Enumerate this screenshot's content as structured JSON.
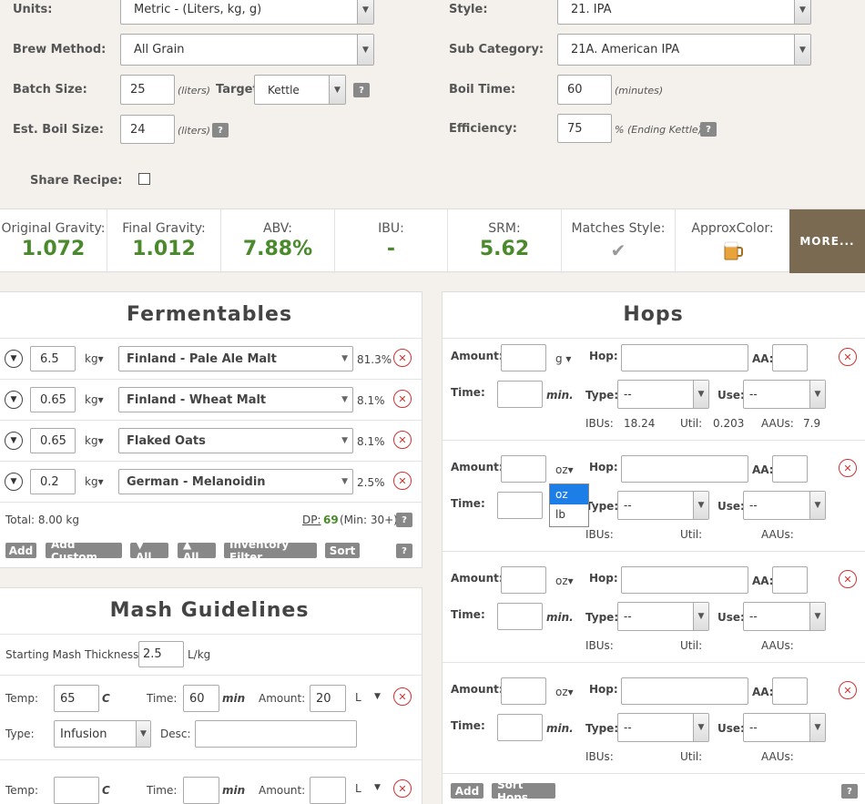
{
  "form": {
    "units_label": "Units:",
    "units_value": "Metric - (Liters, kg, g)",
    "brew_method_label": "Brew Method:",
    "brew_method_value": "All Grain",
    "batch_size_label": "Batch Size:",
    "batch_size_value": "25",
    "batch_unit": "(liters)",
    "target_label": "Target:",
    "target_value": "Kettle",
    "boil_size_label": "Est. Boil Size:",
    "boil_size_value": "24",
    "boil_size_unit": "(liters)",
    "share_label": "Share Recipe:",
    "style_label": "Style:",
    "style_value": "21. IPA",
    "subcat_label": "Sub Category:",
    "subcat_value": "21A. American IPA",
    "boil_time_label": "Boil Time:",
    "boil_time_value": "60",
    "boil_time_unit": "(minutes)",
    "efficiency_label": "Efficiency:",
    "efficiency_value": "75",
    "efficiency_unit": "% (Ending Kettle)",
    "help": "?"
  },
  "stats": {
    "og_label": "Original Gravity:",
    "og": "1.072",
    "fg_label": "Final Gravity:",
    "fg": "1.012",
    "abv_label": "ABV:",
    "abv": "7.88%",
    "ibu_label": "IBU:",
    "ibu": "-",
    "srm_label": "SRM:",
    "srm": "5.62",
    "match_label": "Matches Style:",
    "color_label": "ApproxColor:",
    "more": "MORE..."
  },
  "fermentables": {
    "title": "Fermentables",
    "rows": [
      {
        "amount": "6.5",
        "unit": "kg▾",
        "name": "Finland - Pale Ale Malt",
        "pct": "81.3%"
      },
      {
        "amount": "0.65",
        "unit": "kg▾",
        "name": "Finland - Wheat Malt",
        "pct": "8.1%"
      },
      {
        "amount": "0.65",
        "unit": "kg▾",
        "name": "Flaked Oats",
        "pct": "8.1%"
      },
      {
        "amount": "0.2",
        "unit": "kg▾",
        "name": "German - Melanoidin",
        "pct": "2.5%"
      }
    ],
    "total": "Total: 8.00 kg",
    "dp_label": "DP:",
    "dp_value": "69",
    "dp_min": "(Min: 30+)",
    "buttons": [
      "Add",
      "Add Custom",
      "▼ All",
      "▲ All",
      "Inventory Filter",
      "Sort"
    ]
  },
  "mash": {
    "title": "Mash Guidelines",
    "thickness_label": "Starting Mash Thickness:",
    "thickness_value": "2.5",
    "thickness_unit": "L/kg",
    "temp_label": "Temp:",
    "temp_unit": "C",
    "time_label": "Time:",
    "time_unit": "min",
    "amount_label": "Amount:",
    "amount_unit": "L",
    "type_label": "Type:",
    "desc_label": "Desc:",
    "step1": {
      "temp": "65",
      "time": "60",
      "amount": "20",
      "type": "Infusion"
    }
  },
  "hops": {
    "title": "Hops",
    "amount_label": "Amount:",
    "hop_label": "Hop:",
    "aa_label": "AA:",
    "time_label": "Time:",
    "min_unit": "min.",
    "type_label": "Type:",
    "use_label": "Use:",
    "ibus_label": "IBUs:",
    "util_label": "Util:",
    "aaus_label": "AAUs:",
    "dash": "--",
    "row1": {
      "unit": "g ▾",
      "ibus": "18.24",
      "util": "0.203",
      "aaus": "7.9"
    },
    "unit_oz": "oz▾",
    "dropdown_options": [
      "oz",
      "lb"
    ],
    "add": "Add",
    "sort": "Sort Hops"
  }
}
